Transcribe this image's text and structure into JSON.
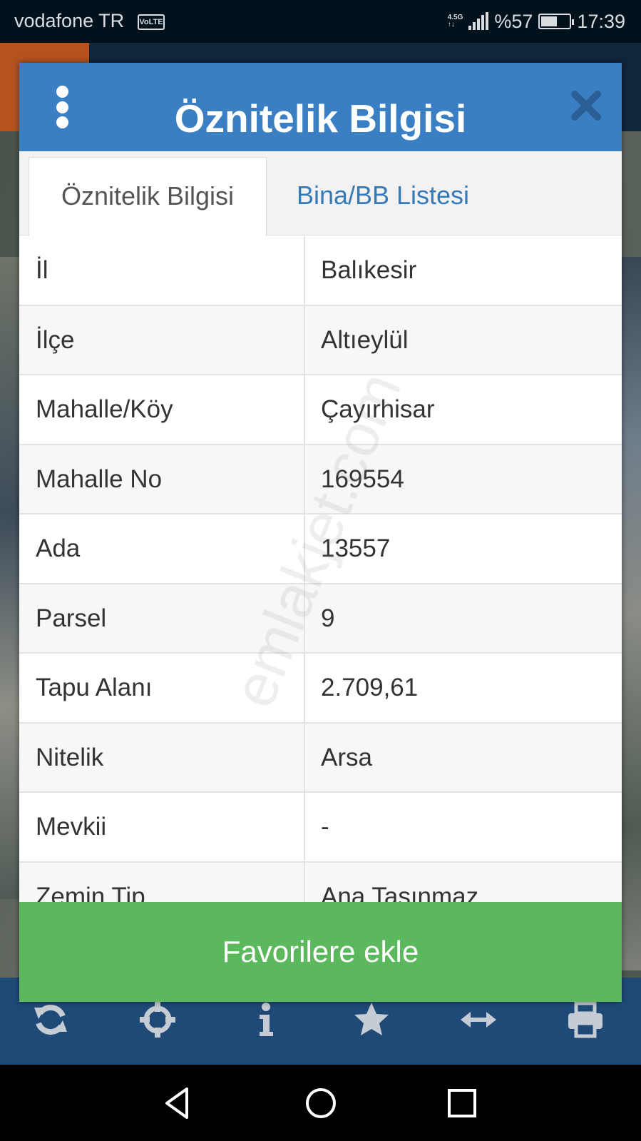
{
  "status_bar": {
    "carrier": "vodafone TR",
    "volte": "VoLTE",
    "network_top": "4.5G",
    "network_bottom": "↑↓",
    "battery_percent": "%57",
    "battery_level": 0.57,
    "time": "17:39"
  },
  "dialog": {
    "title": "Öznitelik Bilgisi",
    "menu_icon": "kebab-menu-icon",
    "close_icon": "close-icon",
    "tabs": [
      {
        "label": "Öznitelik Bilgisi",
        "active": true
      },
      {
        "label": "Bina/BB Listesi",
        "active": false
      }
    ],
    "rows": [
      {
        "key": "İl",
        "value": "Balıkesir"
      },
      {
        "key": "İlçe",
        "value": "Altıeylül"
      },
      {
        "key": "Mahalle/Köy",
        "value": "Çayırhisar"
      },
      {
        "key": "Mahalle No",
        "value": "169554"
      },
      {
        "key": "Ada",
        "value": "13557"
      },
      {
        "key": "Parsel",
        "value": "9"
      },
      {
        "key": "Tapu Alanı",
        "value": "2.709,61"
      },
      {
        "key": "Nitelik",
        "value": "Arsa"
      },
      {
        "key": "Mevkii",
        "value": "-"
      },
      {
        "key": "Zemin Tip",
        "value": "Ana Taşınmaz"
      }
    ],
    "watermark": "emlakjet.com",
    "favorite_button": "Favorilere ekle"
  },
  "toolbar": {
    "icons": [
      "refresh-icon",
      "locate-icon",
      "info-icon",
      "star-icon",
      "measure-icon",
      "print-icon"
    ]
  },
  "nav_bar": {
    "icons": [
      "back-icon",
      "home-icon",
      "recents-icon"
    ]
  },
  "colors": {
    "header_blue": "#3a7fc4",
    "tab_link_blue": "#337ab7",
    "button_green": "#5cb85c",
    "toolbar_blue": "#1f4a78",
    "status_bar_bg": "#02121d"
  }
}
